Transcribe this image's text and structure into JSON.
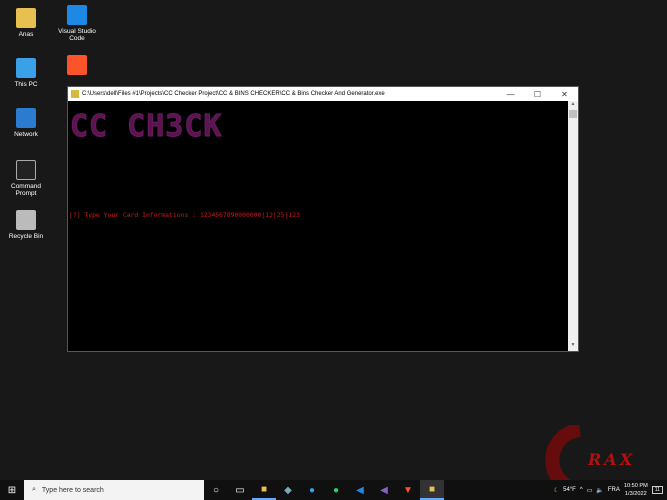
{
  "desktop": {
    "icons": [
      {
        "label": "Anas",
        "icon": "folder-icon"
      },
      {
        "label": "Visual Studio Code",
        "icon": "vscode-icon"
      },
      {
        "label": "This PC",
        "icon": "computer-icon"
      },
      {
        "label": "",
        "icon": "brave-icon"
      },
      {
        "label": "Network",
        "icon": "network-icon"
      },
      {
        "label": "Command Prompt",
        "icon": "cmd-icon"
      },
      {
        "label": "Recycle Bin",
        "icon": "recycle-bin-icon"
      }
    ]
  },
  "window": {
    "title": "C:\\Users\\dell\\Files #1\\Projects\\CC Checker Project\\CC & BINS CHECKER\\CC & Bins Checker And Generator.exe",
    "banner": "CC CH3CK",
    "prompt": "[?] Type Your Card Informations : 1234567890000000|12|25|123",
    "colors": {
      "prompt": "#c8191e",
      "banner": "#4a1040"
    }
  },
  "taskbar": {
    "search_placeholder": "Type here to search",
    "weather": "54°F",
    "language": "FRA",
    "time": "10:50 PM",
    "date": "1/3/2022",
    "notifications": "11"
  },
  "watermark": "RAX"
}
